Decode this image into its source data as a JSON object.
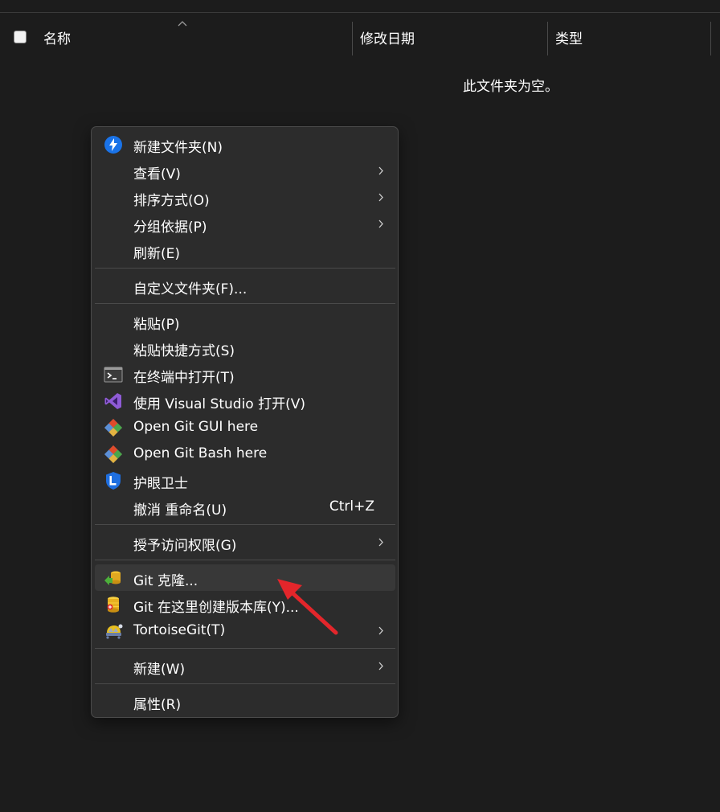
{
  "header": {
    "columns": [
      "名称",
      "修改日期",
      "类型"
    ],
    "sort_direction": "ascending"
  },
  "empty_message": "此文件夹为空。",
  "menu": {
    "items": [
      {
        "label": "新建文件夹(N)",
        "icon": "folder-bolt-icon"
      },
      {
        "label": "查看(V)",
        "submenu": true
      },
      {
        "label": "排序方式(O)",
        "submenu": true
      },
      {
        "label": "分组依据(P)",
        "submenu": true
      },
      {
        "label": "刷新(E)"
      },
      {
        "label": "自定义文件夹(F)..."
      },
      {
        "label": "粘贴(P)"
      },
      {
        "label": "粘贴快捷方式(S)"
      },
      {
        "label": "在终端中打开(T)",
        "icon": "terminal-icon"
      },
      {
        "label": "使用 Visual Studio 打开(V)",
        "icon": "visual-studio-icon"
      },
      {
        "label": "Open Git GUI here",
        "icon": "git-icon"
      },
      {
        "label": "Open Git Bash here",
        "icon": "git-icon"
      },
      {
        "label": "护眼卫士",
        "icon": "eye-guard-icon"
      },
      {
        "label": "撤消 重命名(U)",
        "accelerator": "Ctrl+Z"
      },
      {
        "label": "授予访问权限(G)",
        "submenu": true
      },
      {
        "label": "Git 克隆...",
        "icon": "tortoisegit-clone-icon",
        "highlighted": true
      },
      {
        "label": "Git 在这里创建版本库(Y)...",
        "icon": "tortoisegit-repo-icon"
      },
      {
        "label": "TortoiseGit(T)",
        "icon": "tortoisegit-icon",
        "submenu": true
      },
      {
        "label": "新建(W)",
        "submenu": true
      },
      {
        "label": "属性(R)"
      }
    ]
  },
  "colors": {
    "background": "#1c1c1c",
    "menu_background": "#2c2c2c",
    "hover": "#383838",
    "annotation_arrow": "#e3262b"
  }
}
